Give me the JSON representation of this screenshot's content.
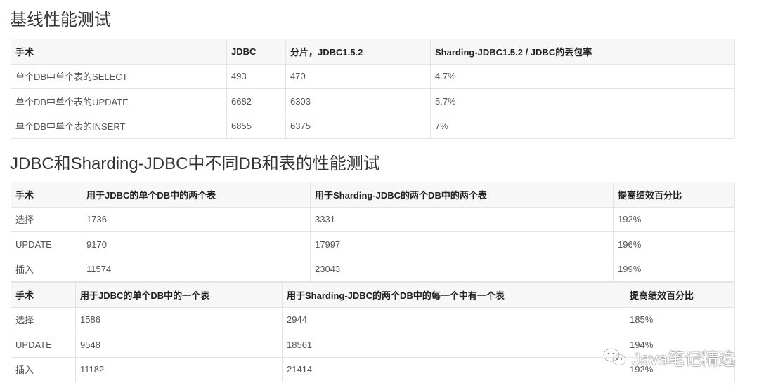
{
  "section1": {
    "title": "基线性能测试",
    "headers": [
      "手术",
      "JDBC",
      "分片，JDBC1.5.2",
      "Sharding-JDBC1.5.2 / JDBC的丢包率"
    ],
    "rows": [
      [
        "单个DB中单个表的SELECT",
        "493",
        "470",
        "4.7%"
      ],
      [
        "单个DB中单个表的UPDATE",
        "6682",
        "6303",
        "5.7%"
      ],
      [
        "单个DB中单个表的INSERT",
        "6855",
        "6375",
        "7%"
      ]
    ]
  },
  "section2": {
    "title": "JDBC和Sharding-JDBC中不同DB和表的性能测试",
    "table_a": {
      "headers": [
        "手术",
        "用于JDBC的单个DB中的两个表",
        "用于Sharding-JDBC的两个DB中的两个表",
        "提高绩效百分比"
      ],
      "rows": [
        [
          "选择",
          "1736",
          "3331",
          "192%"
        ],
        [
          "UPDATE",
          "9170",
          "17997",
          "196%"
        ],
        [
          "插入",
          "11574",
          "23043",
          "199%"
        ]
      ]
    },
    "table_b": {
      "headers": [
        "手术",
        "用于JDBC的单个DB中的一个表",
        "用于Sharding-JDBC的两个DB中的每一个中有一个表",
        "提高绩效百分比"
      ],
      "rows": [
        [
          "选择",
          "1586",
          "2944",
          "185%"
        ],
        [
          "UPDATE",
          "9548",
          "18561",
          "194%"
        ],
        [
          "插入",
          "11182",
          "21414",
          "192%"
        ]
      ]
    }
  },
  "watermark": {
    "text": "Java笔记精选",
    "icon": "wechat-icon"
  }
}
